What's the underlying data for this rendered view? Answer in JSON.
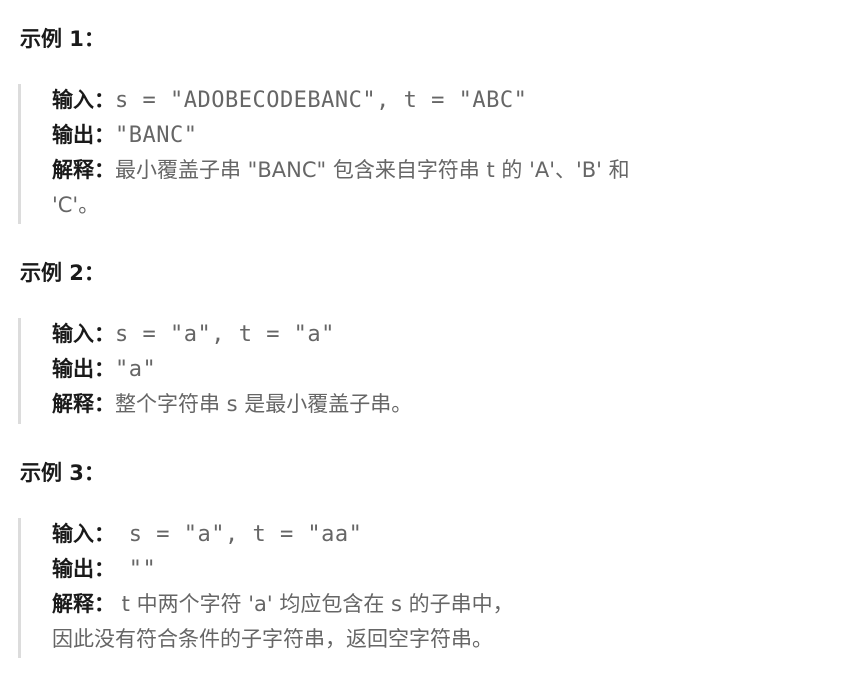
{
  "examples": [
    {
      "title": "示例 1：",
      "input_label": "输入：",
      "input_value": "s = \"ADOBECODEBANC\", t = \"ABC\"",
      "output_label": "输出：",
      "output_value": "\"BANC\"",
      "explain_label": "解释：",
      "explain_line1": "最小覆盖子串 \"BANC\" 包含来自字符串 t 的 'A'、'B' 和",
      "explain_line2": "'C'。"
    },
    {
      "title": "示例 2：",
      "input_label": "输入：",
      "input_value": "s = \"a\", t = \"a\"",
      "output_label": "输出：",
      "output_value": "\"a\"",
      "explain_label": "解释：",
      "explain_line1": "整个字符串 s 是最小覆盖子串。"
    },
    {
      "title": "示例 3：",
      "input_label": "输入：",
      "input_value": " s = \"a\", t = \"aa\"",
      "output_label": "输出：",
      "output_value": " \"\"",
      "explain_label": "解释：",
      "explain_line1": " t 中两个字符 'a' 均应包含在 s 的子串中，",
      "explain_line2": "因此没有符合条件的子字符串，返回空字符串。"
    }
  ]
}
